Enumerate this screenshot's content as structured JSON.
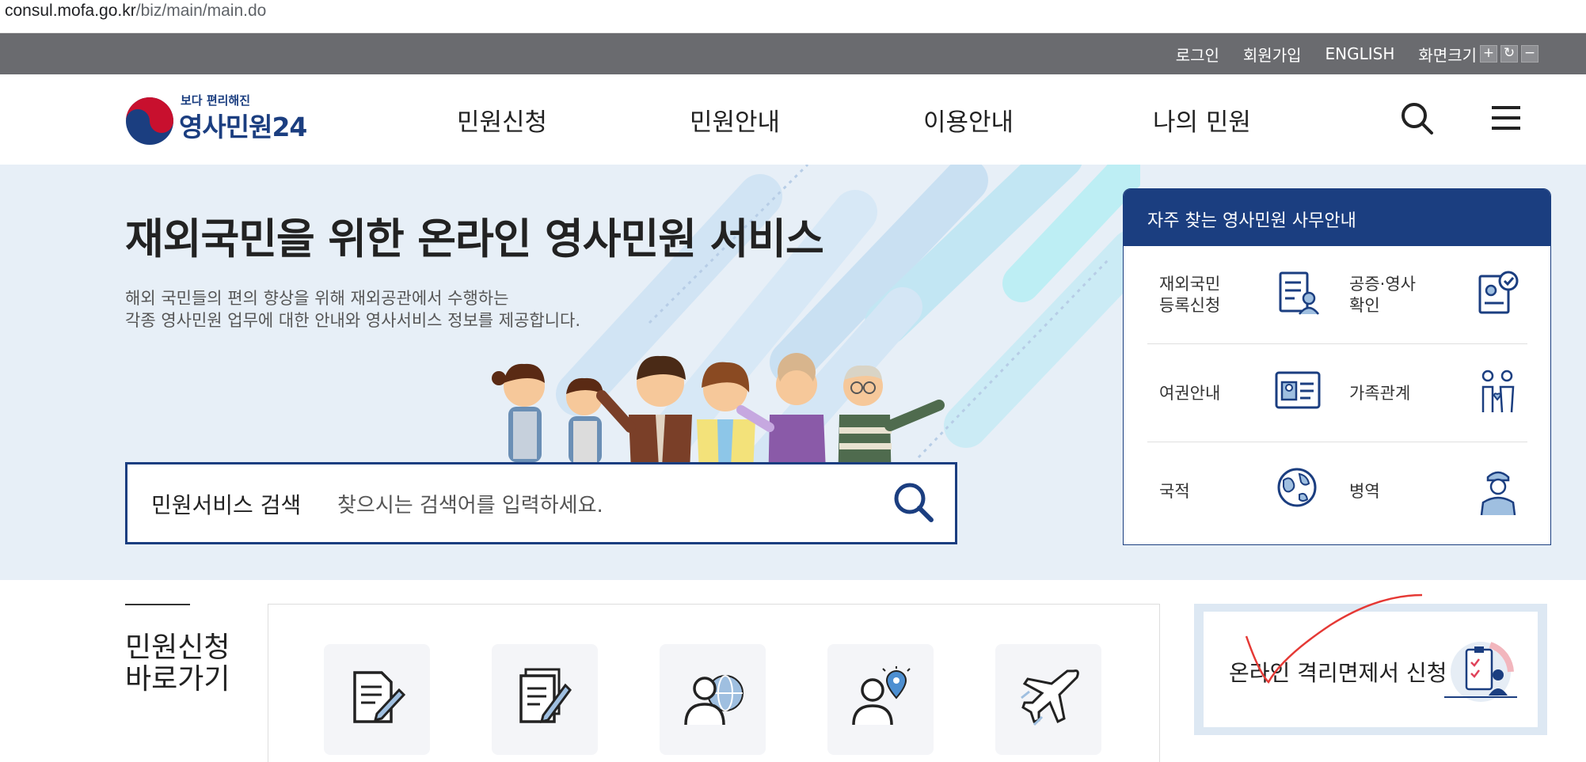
{
  "browser": {
    "url_domain": "consul.mofa.go.kr",
    "url_path": "/biz/main/main.do"
  },
  "topbar": {
    "login": "로그인",
    "signup": "회원가입",
    "english": "ENGLISH",
    "screen_size": "화면크기",
    "zoom_in": "+",
    "zoom_reset": "↻",
    "zoom_out": "−"
  },
  "logo": {
    "tagline": "보다 편리해진",
    "name": "영사민원24"
  },
  "nav": {
    "items": [
      "민원신청",
      "민원안내",
      "이용안내",
      "나의 민원"
    ]
  },
  "hero": {
    "title": "재외국민을 위한 온라인 영사민원 서비스",
    "desc_line1": "해외 국민들의 편의 향상을 위해 재외공관에서 수행하는",
    "desc_line2": "각종 영사민원 업무에 대한 안내와 영사서비스 정보를 제공합니다."
  },
  "search": {
    "label": "민원서비스 검색",
    "placeholder": "찾으시는 검색어를 입력하세요."
  },
  "faq": {
    "title": "자주 찾는 영사민원 사무안내",
    "items": [
      {
        "label_line1": "재외국민",
        "label_line2": "등록신청",
        "icon": "document-person-icon"
      },
      {
        "label_line1": "공증·영사",
        "label_line2": "확인",
        "icon": "certificate-check-icon"
      },
      {
        "label_line1": "여권안내",
        "label_line2": "",
        "icon": "passport-icon"
      },
      {
        "label_line1": "가족관계",
        "label_line2": "",
        "icon": "family-icon"
      },
      {
        "label_line1": "국적",
        "label_line2": "",
        "icon": "globe-icon"
      },
      {
        "label_line1": "병역",
        "label_line2": "",
        "icon": "soldier-icon"
      }
    ]
  },
  "quick": {
    "title_line1": "민원신청",
    "title_line2": "바로가기",
    "items": [
      "document-pen-icon",
      "documents-pen-icon",
      "person-globe-icon",
      "person-location-icon",
      "airplane-icon"
    ]
  },
  "banner": {
    "text": "온라인 격리면제서 신청",
    "icon": "clipboard-check-icon"
  },
  "colors": {
    "brand": "#1b3e80",
    "topbar": "#6a6b6f",
    "hero_bg": "#e7eff7"
  }
}
